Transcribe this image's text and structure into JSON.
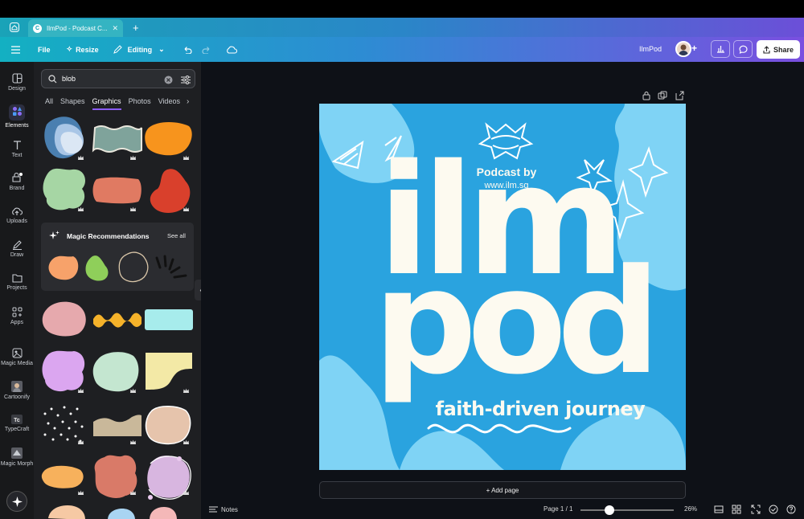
{
  "browser": {
    "tab_title": "IlmPod - Podcast C...",
    "favicon_letter": "C"
  },
  "toolbar": {
    "file_label": "File",
    "resize_label": "Resize",
    "editing_label": "Editing",
    "doc_name": "IlmPod",
    "share_label": "Share"
  },
  "rail": [
    {
      "label": "Design",
      "icon": "design-icon"
    },
    {
      "label": "Elements",
      "icon": "elements-icon"
    },
    {
      "label": "Text",
      "icon": "text-icon"
    },
    {
      "label": "Brand",
      "icon": "brand-icon"
    },
    {
      "label": "Uploads",
      "icon": "uploads-icon"
    },
    {
      "label": "Draw",
      "icon": "draw-icon"
    },
    {
      "label": "Projects",
      "icon": "projects-icon"
    },
    {
      "label": "Apps",
      "icon": "apps-icon"
    },
    {
      "label": "Magic Media",
      "icon": "magic-media-icon"
    },
    {
      "label": "Cartoonify",
      "icon": "cartoonify-icon"
    },
    {
      "label": "TypeCraft",
      "icon": "typecraft-icon"
    },
    {
      "label": "Magic Morph",
      "icon": "magic-morph-icon"
    }
  ],
  "search": {
    "value": "blob"
  },
  "panel_tabs": [
    "All",
    "Shapes",
    "Graphics",
    "Photos",
    "Videos"
  ],
  "active_tab": "Graphics",
  "magic": {
    "title": "Magic Recommendations",
    "see_all": "See all"
  },
  "artboard": {
    "podcast_by": "Podcast by",
    "website": "www.ilm.sg",
    "big_line1": "ilm",
    "big_line2": "pod",
    "tagline": "faith-driven journey"
  },
  "canvas": {
    "add_page": "+ Add page"
  },
  "bottom": {
    "notes": "Notes",
    "page": "Page 1 / 1",
    "zoom": "26%",
    "zoom_level": 0.26
  },
  "colors": {
    "artboard_bg": "#2aa3df",
    "artboard_light_blob": "#7fd3f5",
    "artboard_text": "#fdfaf0",
    "accent": "#8b5cf6"
  }
}
